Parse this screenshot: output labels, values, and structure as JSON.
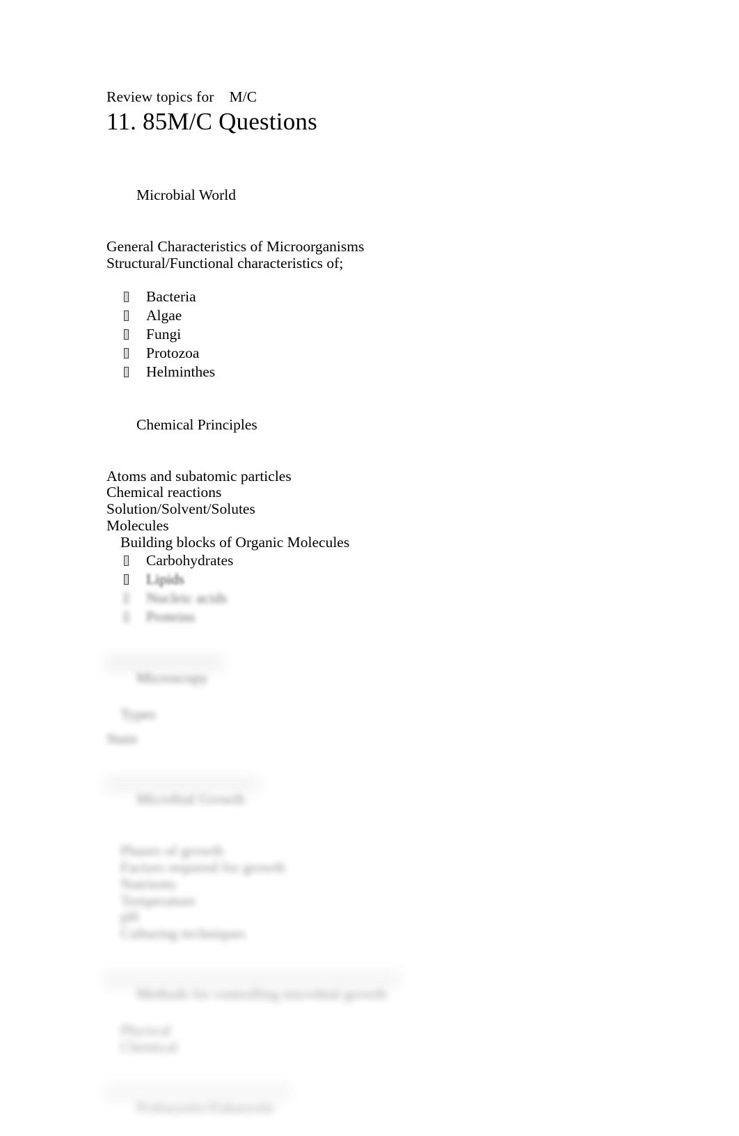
{
  "document": {
    "kicker": "Review topics for    M/C",
    "title": "11. 85M/C Questions"
  },
  "sections": [
    {
      "id": "microbial-world",
      "heading": "Microbial World",
      "lines": [
        "General Characteristics of Microorganisms",
        "Structural/Functional characteristics of;"
      ],
      "bullets": [
        "Bacteria",
        "Algae",
        "Fungi",
        "Protozoa",
        "Helminthes"
      ]
    },
    {
      "id": "chemical-principles",
      "heading": "Chemical Principles",
      "lines": [
        "Atoms and subatomic particles",
        "Chemical reactions",
        "Solution/Solvent/Solutes",
        "Molecules"
      ],
      "sub_line": "Building blocks of Organic Molecules",
      "bullets": [
        "Carbohydrates",
        "Lipids",
        "Nucleic acids",
        "Proteins"
      ]
    },
    {
      "id": "microscopy",
      "heading": "Microscopy",
      "sub_line": "Types",
      "lines": [
        "Stain"
      ]
    },
    {
      "id": "microbial-growth",
      "heading": "Microbial Growth",
      "lines": [
        "Phases of growth",
        "Factors required for growth",
        "Nutrients",
        "Temperature",
        "pH",
        "Culturing techniques"
      ]
    },
    {
      "id": "controlling-growth",
      "heading": "Methods for controlling microbial growth",
      "lines": [
        "Physical",
        "Chemical"
      ]
    },
    {
      "id": "prokaryotic-eukaryotic",
      "heading": "Prokaryotic/Eukaryotic"
    }
  ],
  "bullet_glyph": "tofu-box"
}
